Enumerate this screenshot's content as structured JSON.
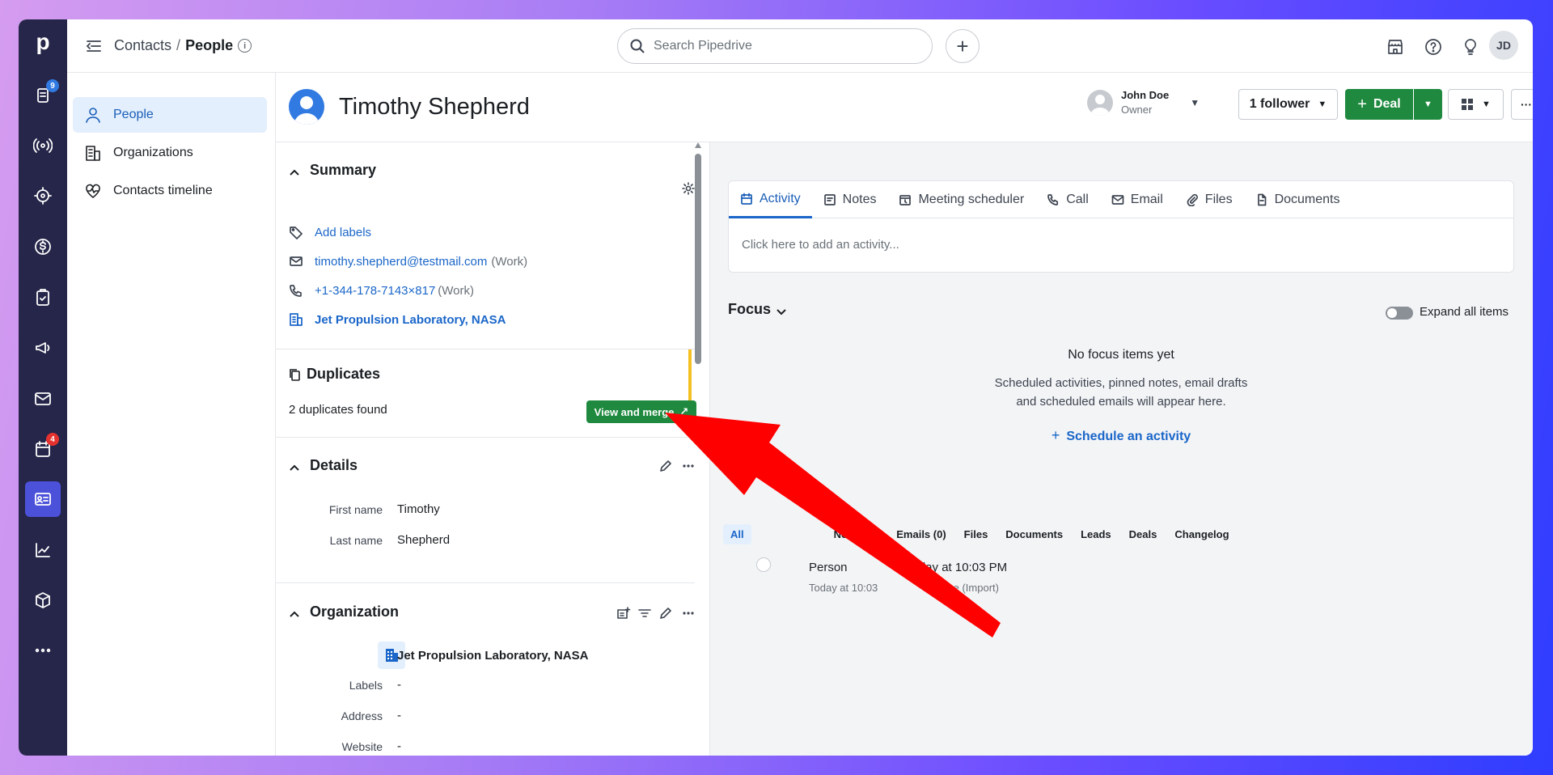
{
  "rail": {
    "logo": "p",
    "items": [
      {
        "name": "deals-icon",
        "badge": "9",
        "badge_color": "#317ae2"
      },
      {
        "name": "leads-icon"
      },
      {
        "name": "target-icon"
      },
      {
        "name": "dollar-icon"
      },
      {
        "name": "tasks-icon"
      },
      {
        "name": "campaigns-icon"
      },
      {
        "name": "mail-icon"
      },
      {
        "name": "calendar-icon",
        "badge": "4",
        "badge_color": "#e5322e"
      },
      {
        "name": "contacts-icon",
        "active": true
      },
      {
        "name": "insights-icon"
      },
      {
        "name": "products-icon"
      },
      {
        "name": "more-icon"
      }
    ]
  },
  "topbar": {
    "breadcrumb_root": "Contacts",
    "breadcrumb_sep": "/",
    "breadcrumb_current": "People",
    "info": "i",
    "search_placeholder": "Search Pipedrive",
    "add": "+",
    "avatar_initials": "JD"
  },
  "subnav": {
    "items": [
      {
        "label": "People",
        "icon": "person-icon",
        "active": true
      },
      {
        "label": "Organizations",
        "icon": "building-icon"
      },
      {
        "label": "Contacts timeline",
        "icon": "heart-pulse-icon"
      }
    ]
  },
  "person": {
    "name": "Timothy Shepherd",
    "owner_name": "John Doe",
    "owner_role": "Owner",
    "follower_label": "1 follower",
    "deal_label": "Deal",
    "more": "···"
  },
  "summary": {
    "title": "Summary",
    "add_labels": "Add labels",
    "email": "timothy.shepherd@testmail.com",
    "email_type": "(Work)",
    "phone": "+1-344-178-7143×817",
    "phone_type": "(Work)",
    "organization": "Jet Propulsion Laboratory, NASA"
  },
  "duplicates": {
    "title": "Duplicates",
    "found_text": "2 duplicates found",
    "button": "View and merge"
  },
  "details": {
    "title": "Details",
    "first_name_label": "First name",
    "first_name": "Timothy",
    "last_name_label": "Last name",
    "last_name": "Shepherd"
  },
  "organization": {
    "title": "Organization",
    "name": "Jet Propulsion Laboratory, NASA",
    "labels_label": "Labels",
    "labels_value": "-",
    "address_label": "Address",
    "address_value": "-",
    "website_label": "Website",
    "website_value": "-"
  },
  "composer": {
    "tabs": [
      "Activity",
      "Notes",
      "Meeting scheduler",
      "Call",
      "Email",
      "Files",
      "Documents"
    ],
    "placeholder": "Click here to add an activity..."
  },
  "focus": {
    "title": "Focus",
    "expand_label": "Expand all items",
    "empty_title": "No focus items yet",
    "empty_line1": "Scheduled activities, pinned notes, email drafts",
    "empty_line2": "and scheduled emails will appear here.",
    "schedule_link": "Schedule an activity"
  },
  "history": {
    "filters": [
      "All",
      "Notes (0)",
      "Emails (0)",
      "Files",
      "Documents",
      "Leads",
      "Deals",
      "Changelog"
    ],
    "item_title": "Person",
    "item_date": "Today at 10:03 PM",
    "item_sub": "Today at 10:03",
    "item_sub2": "Doe (Import)"
  },
  "colors": {
    "rail_bg": "#26264a",
    "accent": "#1a66c9",
    "green": "#1f8a3f",
    "arrow": "#ff0000",
    "duplicate_marker": "#f5c022"
  }
}
